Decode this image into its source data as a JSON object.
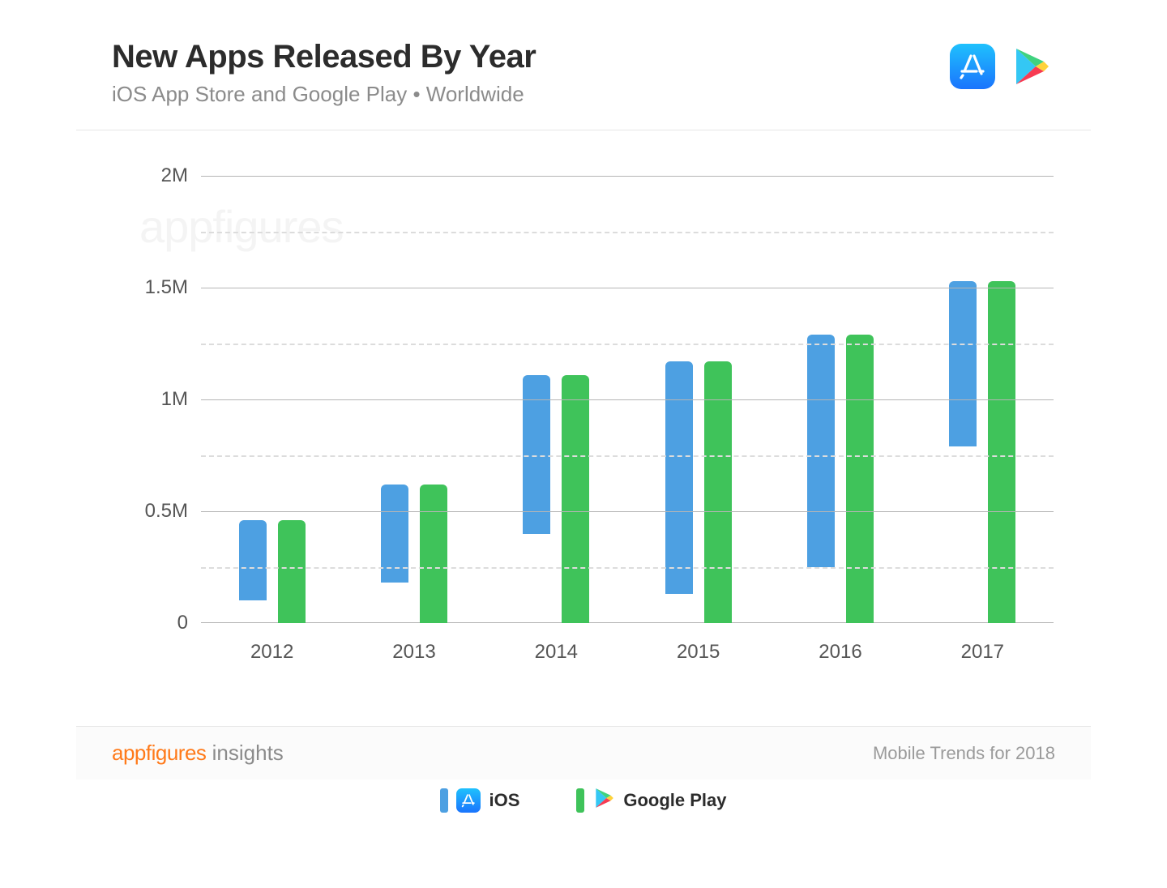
{
  "header": {
    "title": "New Apps Released By Year",
    "subtitle": "iOS App Store and Google Play • Worldwide"
  },
  "watermark": "appfigures",
  "legend": {
    "ios": "iOS",
    "google_play": "Google Play"
  },
  "footer": {
    "brand_highlight": "appfigures",
    "brand_rest": " insights",
    "right": "Mobile Trends for 2018"
  },
  "yaxis_ticks": [
    "0",
    "0.5M",
    "1M",
    "1.5M",
    "2M"
  ],
  "chart_data": {
    "type": "bar",
    "title": "New Apps Released By Year",
    "xlabel": "",
    "ylabel": "",
    "ylim": [
      0,
      2000000
    ],
    "categories": [
      "2012",
      "2013",
      "2014",
      "2015",
      "2016",
      "2017"
    ],
    "series": [
      {
        "name": "iOS",
        "values": [
          360000,
          440000,
          710000,
          1040000,
          1040000,
          740000
        ]
      },
      {
        "name": "Google Play",
        "values": [
          460000,
          620000,
          1110000,
          1170000,
          1290000,
          1530000
        ]
      }
    ]
  }
}
